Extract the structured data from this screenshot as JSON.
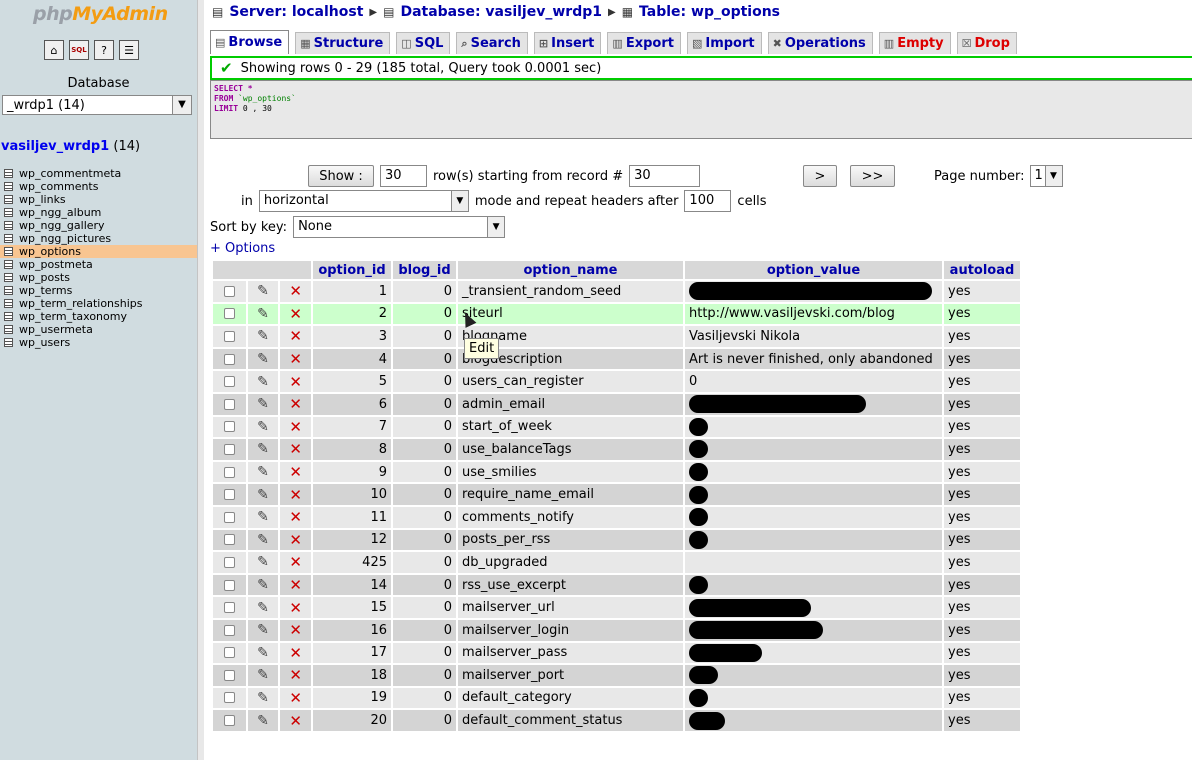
{
  "sidebar": {
    "logo_php": "php",
    "logo_my": "My",
    "logo_admin": "Admin",
    "icons": [
      "home-icon",
      "sql-icon",
      "docs-icon",
      "query-icon"
    ],
    "database_label": "Database",
    "database_select": "_wrdp1 (14)",
    "db_name": "vasiljev_wrdp1",
    "db_count": "(14)",
    "tables": [
      "wp_commentmeta",
      "wp_comments",
      "wp_links",
      "wp_ngg_album",
      "wp_ngg_gallery",
      "wp_ngg_pictures",
      "wp_options",
      "wp_postmeta",
      "wp_posts",
      "wp_terms",
      "wp_term_relationships",
      "wp_term_taxonomy",
      "wp_usermeta",
      "wp_users"
    ],
    "selected_table": "wp_options"
  },
  "breadcrumb": {
    "server": "Server: localhost",
    "database": "Database: vasiljev_wrdp1",
    "table": "Table: wp_options"
  },
  "tabs": [
    {
      "label": "Browse",
      "active": true
    },
    {
      "label": "Structure"
    },
    {
      "label": "SQL"
    },
    {
      "label": "Search"
    },
    {
      "label": "Insert"
    },
    {
      "label": "Export"
    },
    {
      "label": "Import"
    },
    {
      "label": "Operations"
    },
    {
      "label": "Empty",
      "danger": true
    },
    {
      "label": "Drop",
      "danger": true
    }
  ],
  "message": "Showing rows 0 - 29 (185 total, Query took 0.0001 sec)",
  "sql": {
    "select": "SELECT",
    "star": "*",
    "from": "FROM",
    "table": "`wp_options`",
    "limit": "LIMIT",
    "limit_vals": "0 , 30"
  },
  "nav": {
    "show_button": "Show :",
    "rows_value": "30",
    "rows_text": "row(s) starting from record #",
    "start_value": "30",
    "next_button": ">",
    "last_button": ">>",
    "page_label": "Page number:",
    "page_value": "1",
    "in_text": "in",
    "mode_value": "horizontal",
    "mode_text": "mode and repeat headers after",
    "repeat_value": "100",
    "cells_text": "cells",
    "sort_label": "Sort by key:",
    "sort_value": "None",
    "options_link": "+ Options"
  },
  "table": {
    "headers": [
      "option_id",
      "blog_id",
      "option_name",
      "option_value",
      "autoload"
    ],
    "rows": [
      {
        "id": "1",
        "blog": "0",
        "name": "_transient_random_seed",
        "value": "",
        "redacted": 1,
        "autoload": "yes"
      },
      {
        "id": "2",
        "blog": "0",
        "name": "siteurl",
        "value": "http://www.vasiljevski.com/blog",
        "autoload": "yes",
        "highlight": true
      },
      {
        "id": "3",
        "blog": "0",
        "name": "blogname",
        "value": "Vasiljevski Nikola",
        "autoload": "yes"
      },
      {
        "id": "4",
        "blog": "0",
        "name": "blogdescription",
        "value": "Art is never finished, only abandoned",
        "autoload": "yes"
      },
      {
        "id": "5",
        "blog": "0",
        "name": "users_can_register",
        "value": "0",
        "autoload": "yes"
      },
      {
        "id": "6",
        "blog": "0",
        "name": "admin_email",
        "value": "",
        "redacted": 0.73,
        "autoload": "yes"
      },
      {
        "id": "7",
        "blog": "0",
        "name": "start_of_week",
        "value": "",
        "redacted": 0.08,
        "autoload": "yes"
      },
      {
        "id": "8",
        "blog": "0",
        "name": "use_balanceTags",
        "value": "",
        "redacted": 0.08,
        "autoload": "yes"
      },
      {
        "id": "9",
        "blog": "0",
        "name": "use_smilies",
        "value": "",
        "redacted": 0.08,
        "autoload": "yes"
      },
      {
        "id": "10",
        "blog": "0",
        "name": "require_name_email",
        "value": "",
        "redacted": 0.08,
        "autoload": "yes"
      },
      {
        "id": "11",
        "blog": "0",
        "name": "comments_notify",
        "value": "",
        "redacted": 0.08,
        "autoload": "yes"
      },
      {
        "id": "12",
        "blog": "0",
        "name": "posts_per_rss",
        "value": "",
        "redacted": 0.08,
        "autoload": "yes"
      },
      {
        "id": "425",
        "blog": "0",
        "name": "db_upgraded",
        "value": "",
        "autoload": "yes"
      },
      {
        "id": "14",
        "blog": "0",
        "name": "rss_use_excerpt",
        "value": "",
        "redacted": 0.08,
        "autoload": "yes"
      },
      {
        "id": "15",
        "blog": "0",
        "name": "mailserver_url",
        "value": "",
        "redacted": 0.5,
        "autoload": "yes"
      },
      {
        "id": "16",
        "blog": "0",
        "name": "mailserver_login",
        "value": "",
        "redacted": 0.55,
        "autoload": "yes"
      },
      {
        "id": "17",
        "blog": "0",
        "name": "mailserver_pass",
        "value": "",
        "redacted": 0.3,
        "autoload": "yes"
      },
      {
        "id": "18",
        "blog": "0",
        "name": "mailserver_port",
        "value": "",
        "redacted": 0.12,
        "autoload": "yes"
      },
      {
        "id": "19",
        "blog": "0",
        "name": "default_category",
        "value": "",
        "redacted": 0.08,
        "autoload": "yes"
      },
      {
        "id": "20",
        "blog": "0",
        "name": "default_comment_status",
        "value": "",
        "redacted": 0.15,
        "autoload": "yes"
      }
    ]
  },
  "tooltip": "Edit",
  "colors": {
    "sidebar_bg": "#d0dce0",
    "link": "#0000aa",
    "selected_table": "#f8c591",
    "success_border": "#00cc00",
    "highlight_row": "#ccffcc",
    "danger": "#dd0000"
  }
}
